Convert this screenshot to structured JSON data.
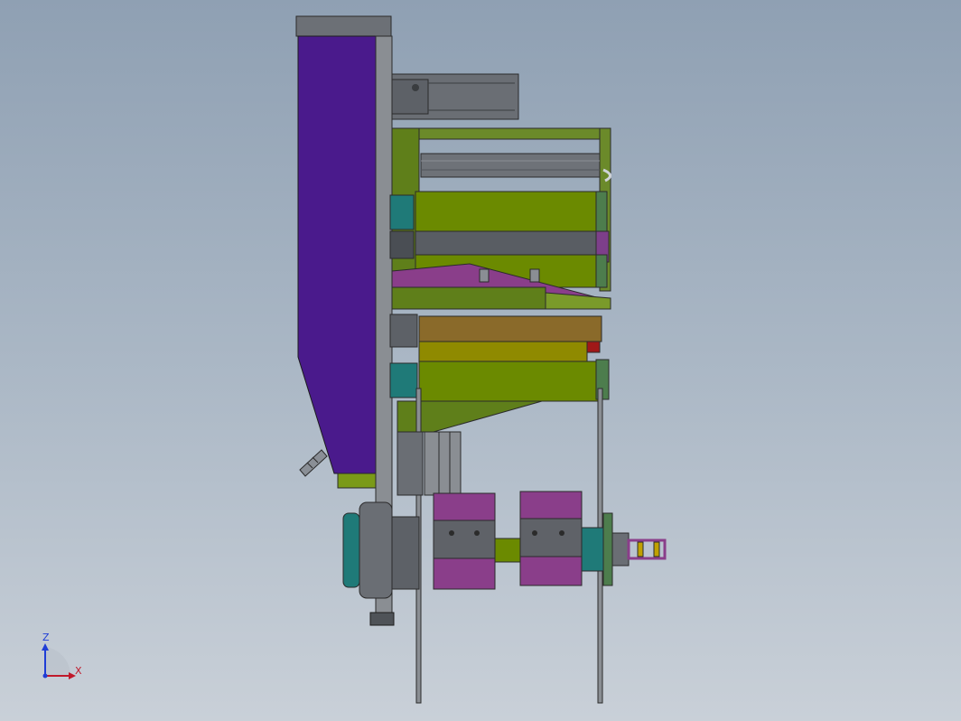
{
  "viewport": {
    "background_top": "#8fa0b3",
    "background_bottom": "#c9d0d8"
  },
  "triad": {
    "z_label": "Z",
    "x_label": "X",
    "z_color": "#1f3dd6",
    "x_color": "#c0192b"
  },
  "part_colors": {
    "hopper": "#4a1a8c",
    "frame": "#5a5f66",
    "roller": "#6b8a00",
    "green_frame": "#5f7f1a",
    "teal": "#1f7a78",
    "magenta": "#8a3e8a"
  }
}
